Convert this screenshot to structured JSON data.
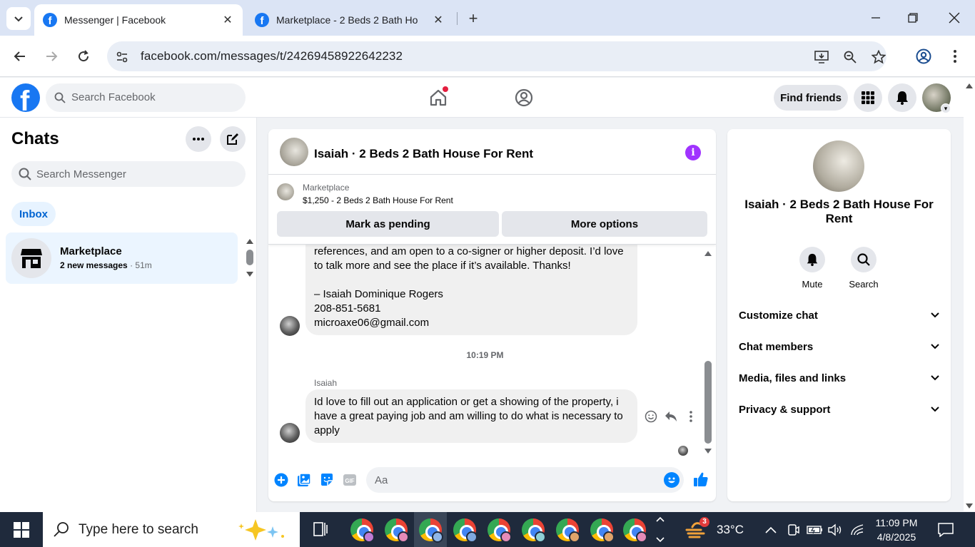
{
  "browser": {
    "tabs": [
      {
        "title": "Messenger | Facebook",
        "active": true
      },
      {
        "title": "Marketplace - 2 Beds 2 Bath Ho",
        "active": false
      }
    ],
    "url": "facebook.com/messages/t/24269458922642232"
  },
  "fb": {
    "search_placeholder": "Search Facebook",
    "find_friends": "Find friends"
  },
  "sidebar": {
    "title": "Chats",
    "search_placeholder": "Search Messenger",
    "inbox_label": "Inbox",
    "chats": [
      {
        "name": "Marketplace",
        "preview": "2 new messages",
        "time": " · 51m"
      }
    ]
  },
  "conversation": {
    "title": "Isaiah · 2 Beds 2 Bath House For Rent",
    "listing": {
      "label": "Marketplace",
      "price_title": "$1,250 - 2 Beds 2 Bath House For Rent",
      "mark_pending": "Mark as pending",
      "more_options": "More options"
    },
    "messages": [
      {
        "lines": [
          "references, and am open to a co-signer or higher deposit. I’d love",
          "to talk more and see the place if it’s available. Thanks!",
          "",
          "– Isaiah Dominique Rogers",
          "208-851-5681",
          "microaxe06@gmail.com"
        ]
      },
      {
        "timestamp": "10:19 PM",
        "sender": "Isaiah",
        "lines": [
          "Id love to fill out an application or get a showing of the property, i",
          "have a great paying job and am willing to do what is necessary to",
          "apply"
        ]
      }
    ],
    "composer_placeholder": "Aa"
  },
  "info_panel": {
    "name": "Isaiah · 2 Beds 2 Bath House For Rent",
    "actions": [
      {
        "label": "Mute",
        "icon": "bell-icon"
      },
      {
        "label": "Search",
        "icon": "search-icon"
      }
    ],
    "sections": [
      "Customize chat",
      "Chat members",
      "Media, files and links",
      "Privacy & support"
    ]
  },
  "taskbar": {
    "search_placeholder": "Type here to search",
    "weather_temp": "33°C",
    "weather_badge": "3",
    "time": "11:09 PM",
    "date": "4/8/2025"
  },
  "colors": {
    "fb_blue": "#1877f2",
    "messenger_purple": "#a033ff",
    "taskbar": "#1f2a3c"
  }
}
